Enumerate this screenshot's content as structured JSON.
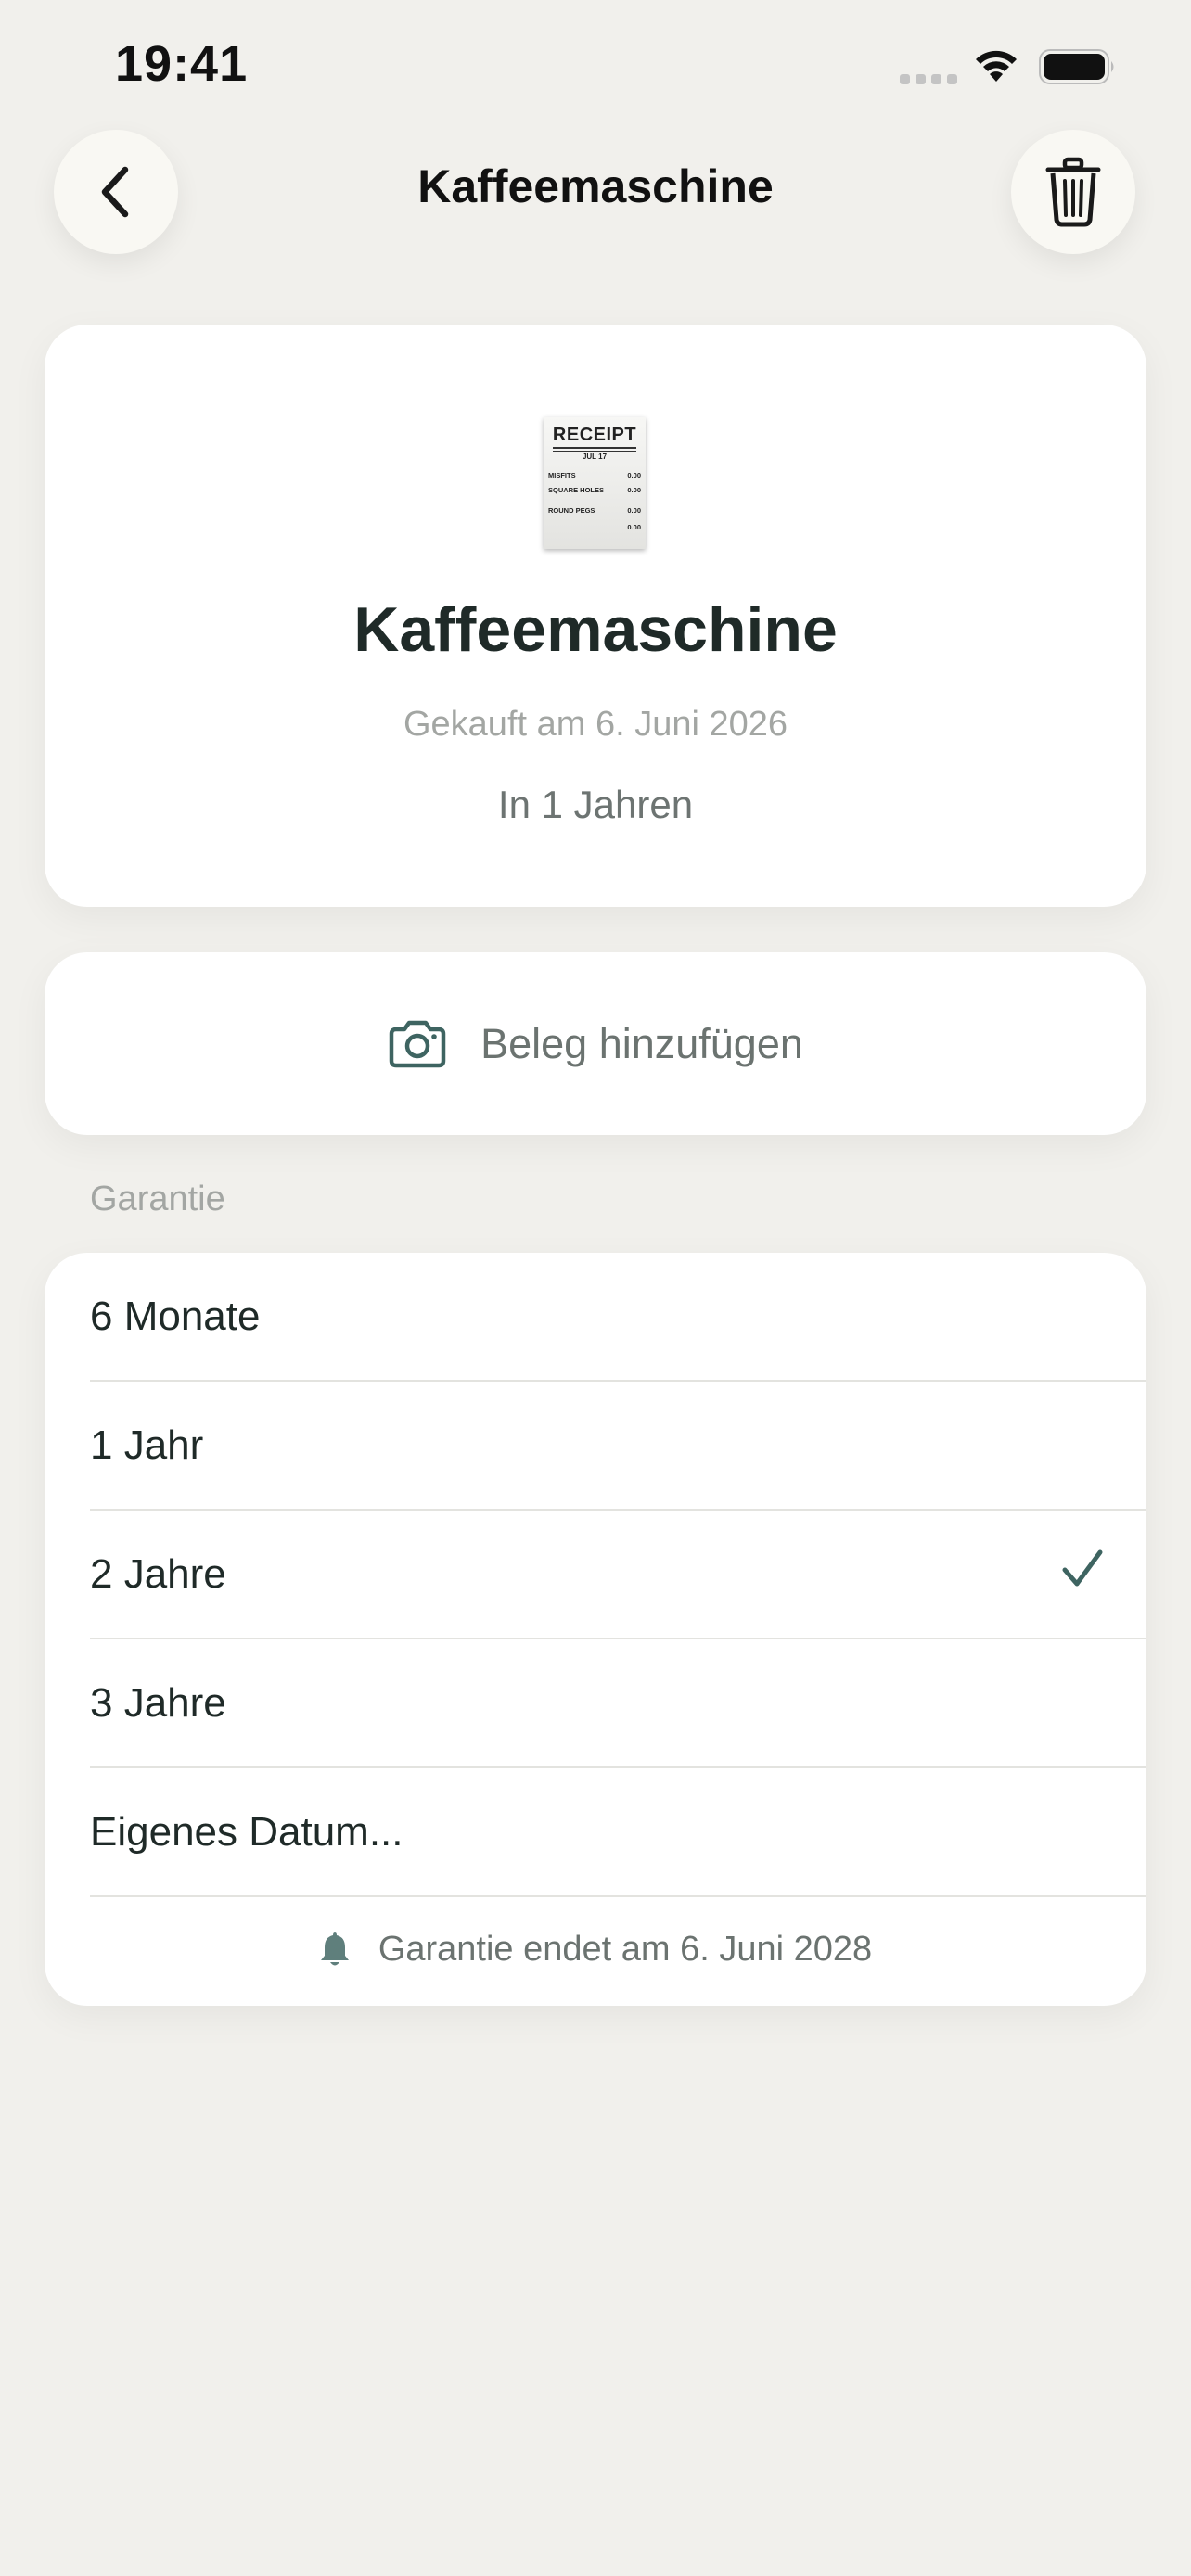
{
  "status_bar": {
    "time": "19:41"
  },
  "nav": {
    "title": "Kaffeemaschine",
    "back_icon": "chevron-left-icon",
    "delete_icon": "trash-icon"
  },
  "item": {
    "receipt_image": {
      "title": "RECEIPT",
      "date": "JUL 17",
      "lines": [
        {
          "label": "MISFITS",
          "value": "0.00"
        },
        {
          "label": "SQUARE HOLES",
          "value": "0.00"
        },
        {
          "label": "ROUND PEGS",
          "value": "0.00"
        },
        {
          "label": "",
          "value": "0.00"
        }
      ]
    },
    "name": "Kaffeemaschine",
    "purchase_date": "Gekauft am 6. Juni 2026",
    "remaining": "In 1 Jahren"
  },
  "receipt_button": {
    "label": "Beleg hinzufügen",
    "icon": "camera-icon"
  },
  "warranty": {
    "section_label": "Garantie",
    "options": [
      {
        "label": "6 Monate",
        "selected": false
      },
      {
        "label": "1 Jahr",
        "selected": false
      },
      {
        "label": "2 Jahre",
        "selected": true
      },
      {
        "label": "3 Jahre",
        "selected": false
      },
      {
        "label": "Eigenes Datum...",
        "selected": false
      }
    ],
    "end_notice": "Garantie endet am 6. Juni 2028",
    "end_icon": "bell-icon"
  },
  "colors": {
    "background": "#f1f0ec",
    "card": "#ffffff",
    "accent": "#3e6461",
    "text_primary": "#1f2a28",
    "text_secondary": "#6b7370",
    "text_muted": "#a3a6a3"
  }
}
